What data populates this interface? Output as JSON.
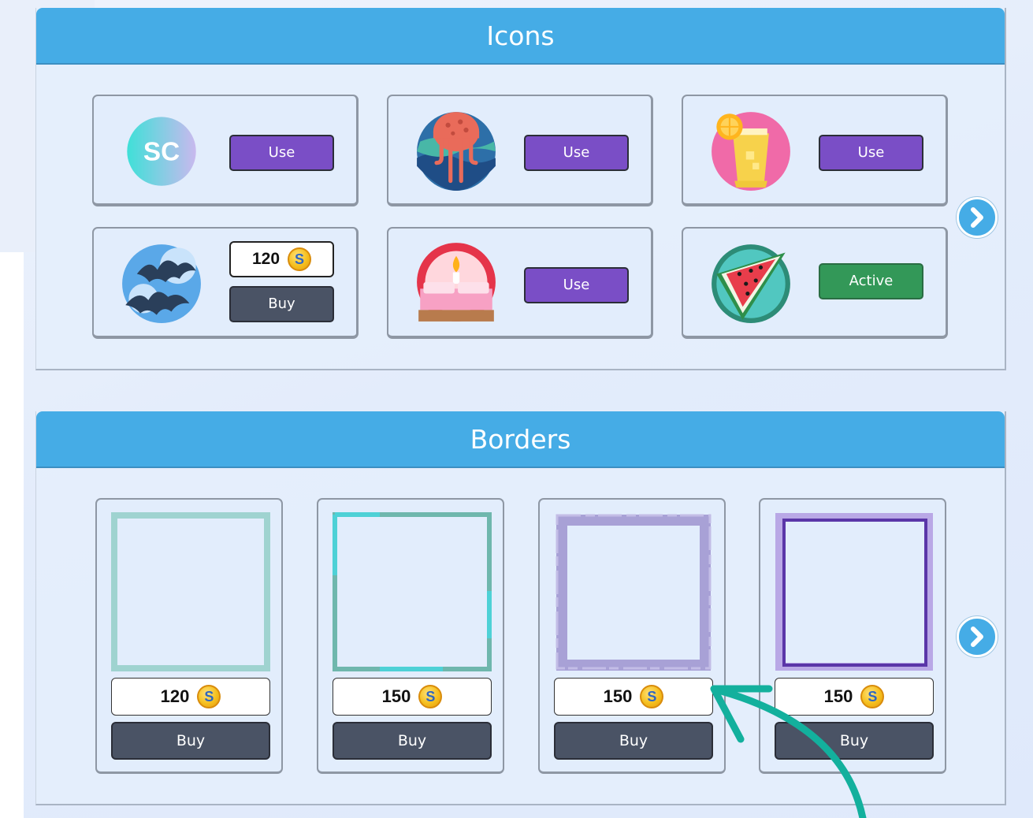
{
  "icons_section": {
    "title": "Icons",
    "items": [
      {
        "icon": "sc-logo-icon",
        "action": "Use"
      },
      {
        "icon": "jellyfish-icon",
        "action": "Use"
      },
      {
        "icon": "lemonade-icon",
        "action": "Use"
      },
      {
        "icon": "bats-icon",
        "price": "120",
        "action": "Buy"
      },
      {
        "icon": "candle-bed-icon",
        "action": "Use"
      },
      {
        "icon": "watermelon-icon",
        "action": "Active"
      }
    ],
    "next": "chevron-right-icon"
  },
  "borders_section": {
    "title": "Borders",
    "items": [
      {
        "frame": "light-teal-frame",
        "price": "120",
        "action": "Buy"
      },
      {
        "frame": "teal-multicolor-frame",
        "price": "150",
        "action": "Buy"
      },
      {
        "frame": "lavender-brush-frame",
        "price": "150",
        "action": "Buy"
      },
      {
        "frame": "purple-sketch-frame",
        "price": "150",
        "action": "Buy"
      }
    ],
    "next": "chevron-right-icon"
  },
  "coin_symbol": "S",
  "colors": {
    "header": "#45ace6",
    "use_button": "#7a4ec6",
    "active_button": "#339858",
    "buy_button": "#4a5365",
    "annotation_arrow": "#13b09d"
  }
}
